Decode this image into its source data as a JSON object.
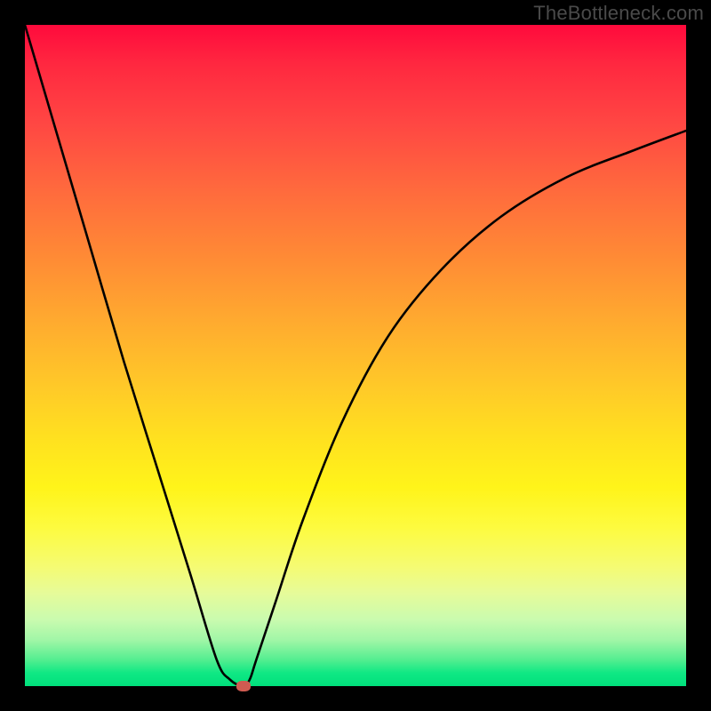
{
  "watermark": "TheBottleneck.com",
  "colors": {
    "frame_bg": "#000000",
    "curve": "#000000",
    "dot": "#cf5b51",
    "watermark_text": "#4a4a4a"
  },
  "chart_data": {
    "type": "line",
    "title": "",
    "xlabel": "",
    "ylabel": "",
    "xlim": [
      0,
      100
    ],
    "ylim": [
      0,
      100
    ],
    "grid": false,
    "legend": false,
    "series": [
      {
        "name": "bottleneck-curve",
        "x": [
          0,
          5,
          10,
          15,
          20,
          25,
          29,
          31,
          33,
          34,
          35,
          38,
          42,
          48,
          55,
          63,
          72,
          82,
          92,
          100
        ],
        "values": [
          100,
          83,
          66,
          49,
          33,
          17,
          4,
          1,
          0,
          1,
          4,
          13,
          25,
          40,
          53,
          63,
          71,
          77,
          81,
          84
        ]
      }
    ],
    "marker": {
      "x": 33,
      "y": 0
    },
    "background_gradient": {
      "top_color": "#ff0a3c",
      "bottom_color": "#00e07c",
      "description": "vertical red-to-green through yellow"
    }
  }
}
